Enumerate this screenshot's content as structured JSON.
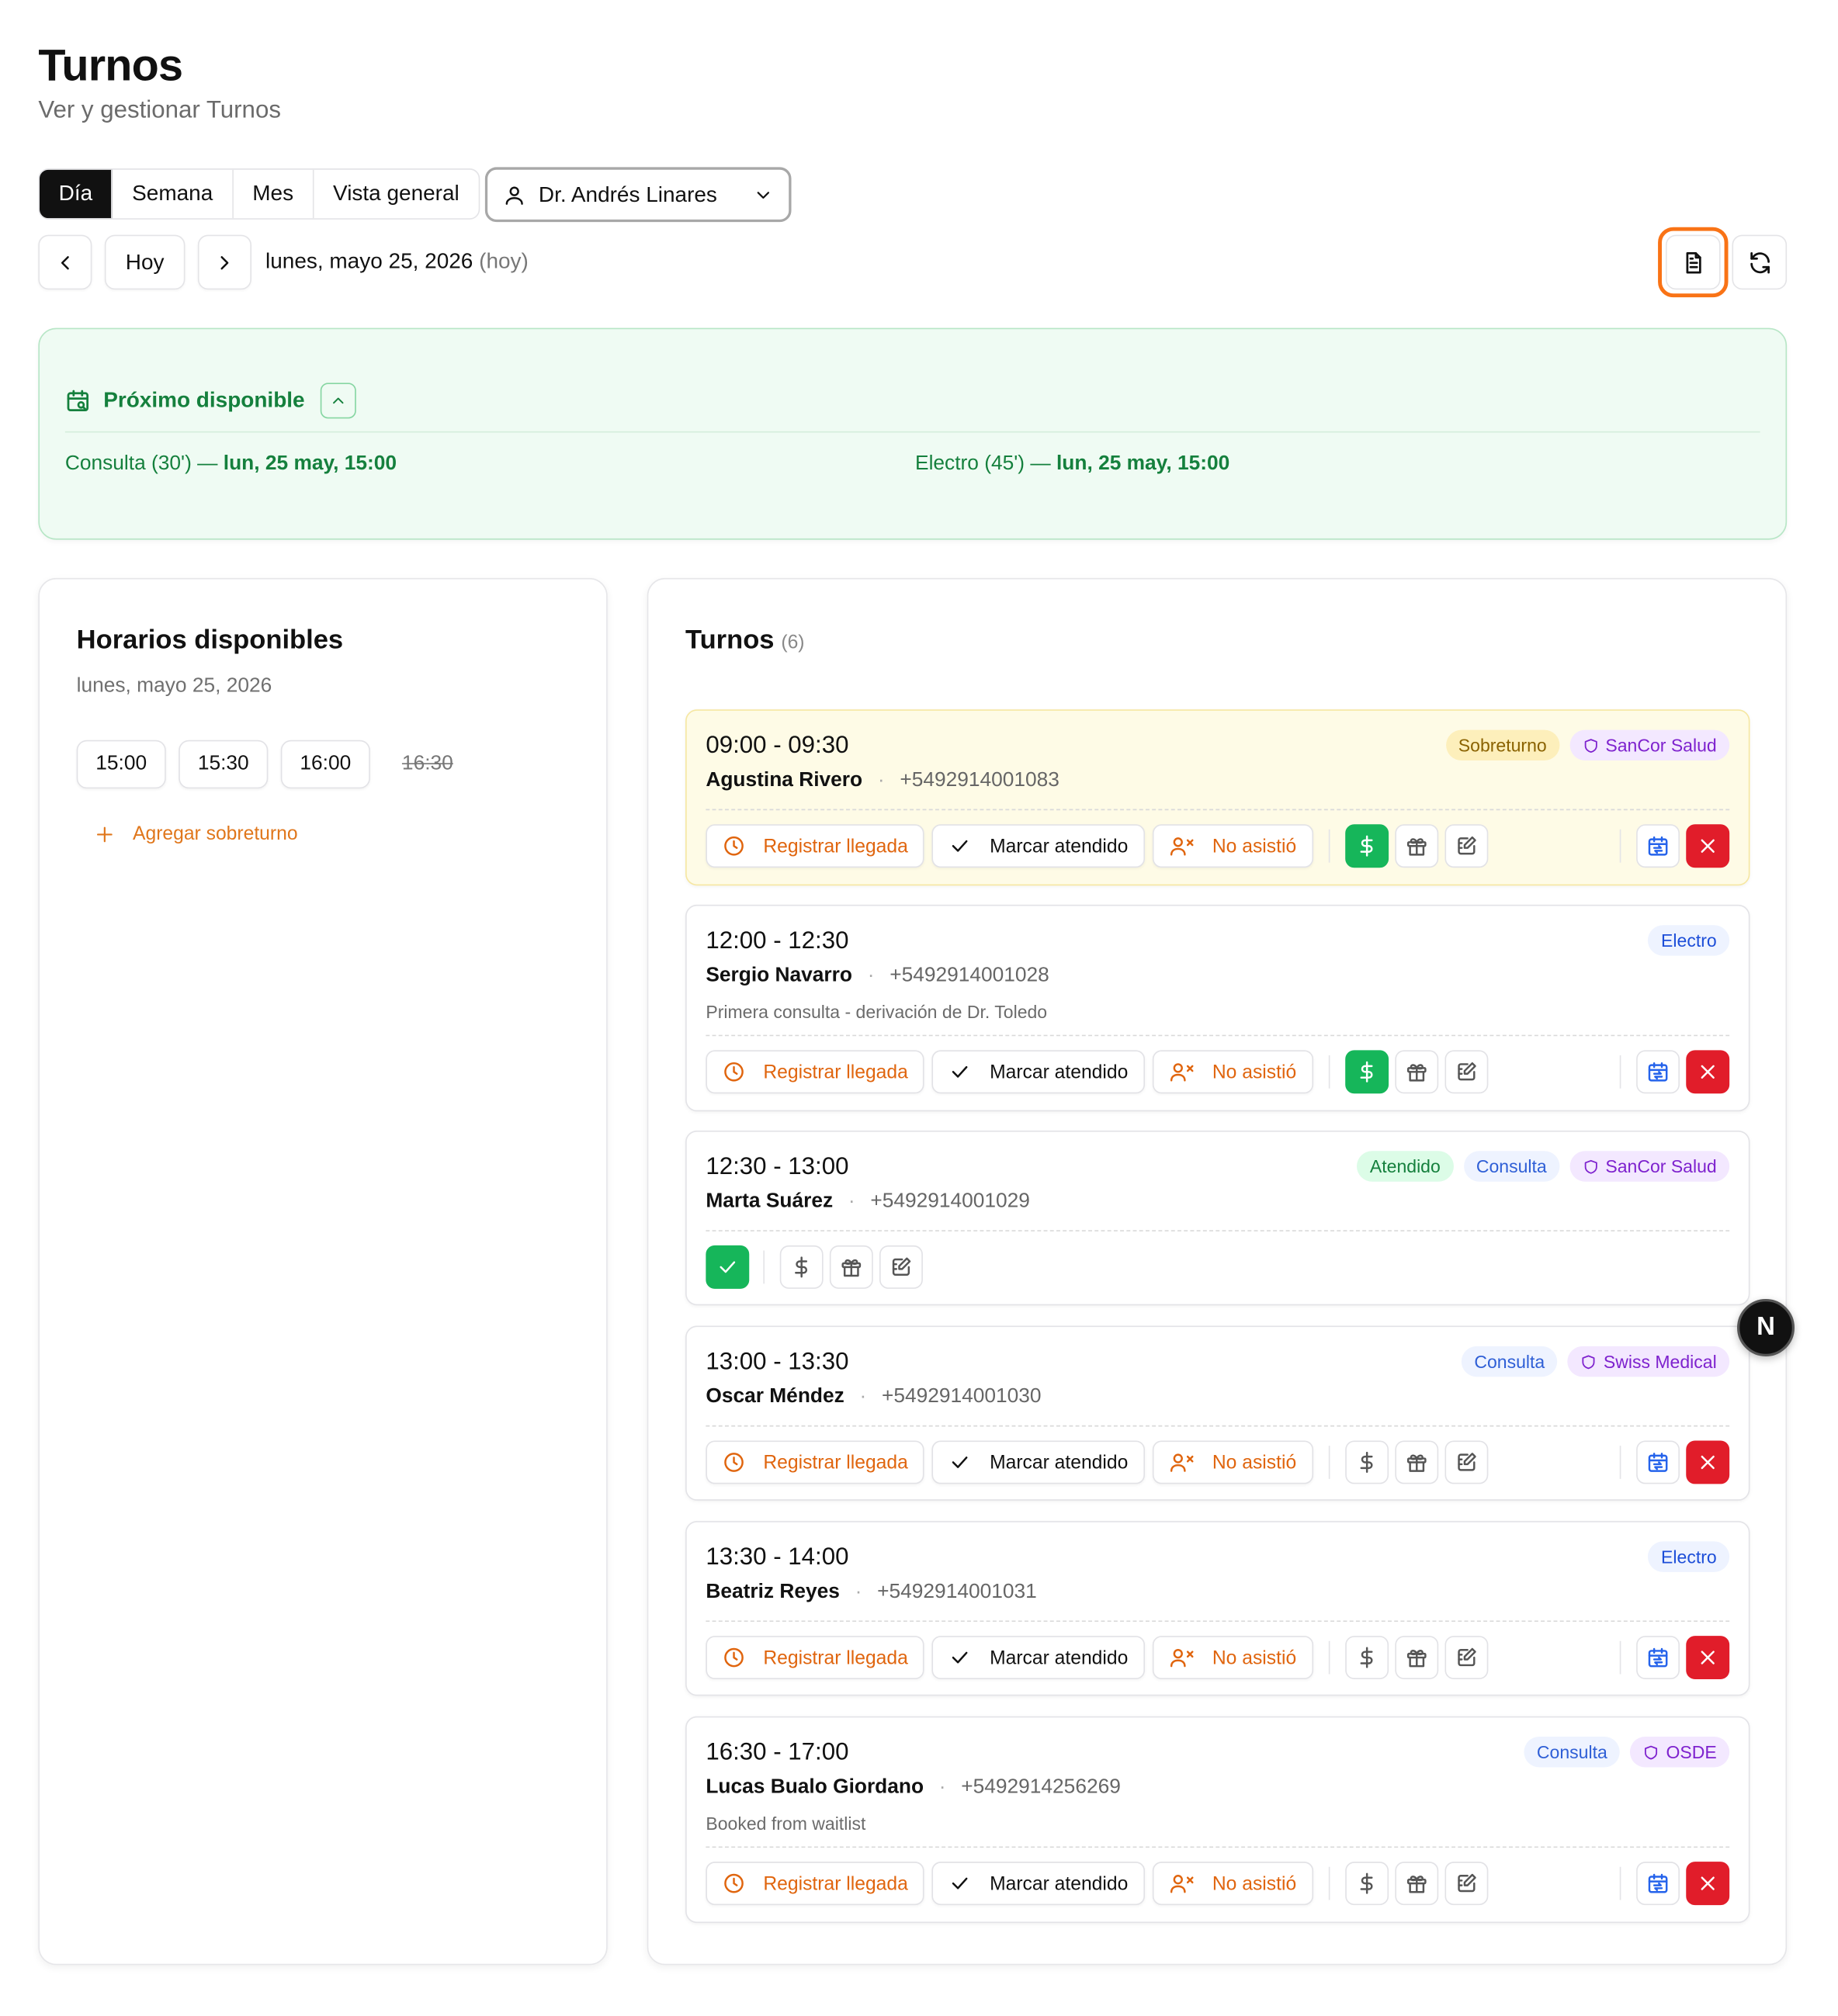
{
  "header": {
    "title": "Turnos",
    "subtitle": "Ver y gestionar Turnos"
  },
  "view_tabs": [
    "Día",
    "Semana",
    "Mes",
    "Vista general"
  ],
  "active_tab": "Día",
  "doctor_select": {
    "value": "Dr. Andrés Linares"
  },
  "date_nav": {
    "today_label": "Hoy",
    "date": "lunes, mayo 25, 2026",
    "today_hint": "(hoy)"
  },
  "next_available": {
    "title": "Próximo disponible",
    "items": [
      {
        "service": "Consulta (30')",
        "sep": "—",
        "when": "lun, 25 may, 15:00"
      },
      {
        "service": "Electro (45')",
        "sep": "—",
        "when": "lun, 25 may, 15:00"
      }
    ]
  },
  "slots": {
    "title": "Horarios disponibles",
    "date": "lunes, mayo 25, 2026",
    "times": [
      {
        "time": "15:00",
        "taken": false
      },
      {
        "time": "15:30",
        "taken": false
      },
      {
        "time": "16:00",
        "taken": false
      },
      {
        "time": "16:30",
        "taken": true
      }
    ],
    "add_label": "Agregar sobreturno"
  },
  "appointments": {
    "title": "Turnos",
    "count": "(6)",
    "labels": {
      "register": "Registrar llegada",
      "attended": "Marcar atendido",
      "noshow": "No asistió"
    },
    "items": [
      {
        "time": "09:00 - 09:30",
        "name": "Agustina Rivero",
        "phone": "+5492914001083",
        "note": "",
        "overbooking": true,
        "attended": false,
        "paid": true,
        "badges": [
          {
            "text": "Sobreturno",
            "kind": "sobre"
          },
          {
            "text": "SanCor Salud",
            "kind": "ins"
          }
        ]
      },
      {
        "time": "12:00 - 12:30",
        "name": "Sergio Navarro",
        "phone": "+5492914001028",
        "note": "Primera consulta - derivación de Dr. Toledo",
        "overbooking": false,
        "attended": false,
        "paid": true,
        "badges": [
          {
            "text": "Electro",
            "kind": "electro"
          }
        ]
      },
      {
        "time": "12:30 - 13:00",
        "name": "Marta Suárez",
        "phone": "+5492914001029",
        "note": "",
        "overbooking": false,
        "attended": true,
        "paid": false,
        "badges": [
          {
            "text": "Atendido",
            "kind": "atendido"
          },
          {
            "text": "Consulta",
            "kind": "consulta"
          },
          {
            "text": "SanCor Salud",
            "kind": "ins"
          }
        ]
      },
      {
        "time": "13:00 - 13:30",
        "name": "Oscar Méndez",
        "phone": "+5492914001030",
        "note": "",
        "overbooking": false,
        "attended": false,
        "paid": false,
        "badges": [
          {
            "text": "Consulta",
            "kind": "consulta"
          },
          {
            "text": "Swiss Medical",
            "kind": "ins"
          }
        ]
      },
      {
        "time": "13:30 - 14:00",
        "name": "Beatriz Reyes",
        "phone": "+5492914001031",
        "note": "",
        "overbooking": false,
        "attended": false,
        "paid": false,
        "badges": [
          {
            "text": "Electro",
            "kind": "electro"
          }
        ]
      },
      {
        "time": "16:30 - 17:00",
        "name": "Lucas Bualo Giordano",
        "phone": "+5492914256269",
        "note": "Booked from waitlist",
        "overbooking": false,
        "attended": false,
        "paid": false,
        "badges": [
          {
            "text": "Consulta",
            "kind": "consulta"
          },
          {
            "text": "OSDE",
            "kind": "ins"
          }
        ]
      }
    ]
  },
  "floating_badge": "N",
  "colors": {
    "accent_orange": "#f97316",
    "success_green": "#16b65a",
    "danger_red": "#e11d2a",
    "next_panel_green": "#15803d"
  }
}
